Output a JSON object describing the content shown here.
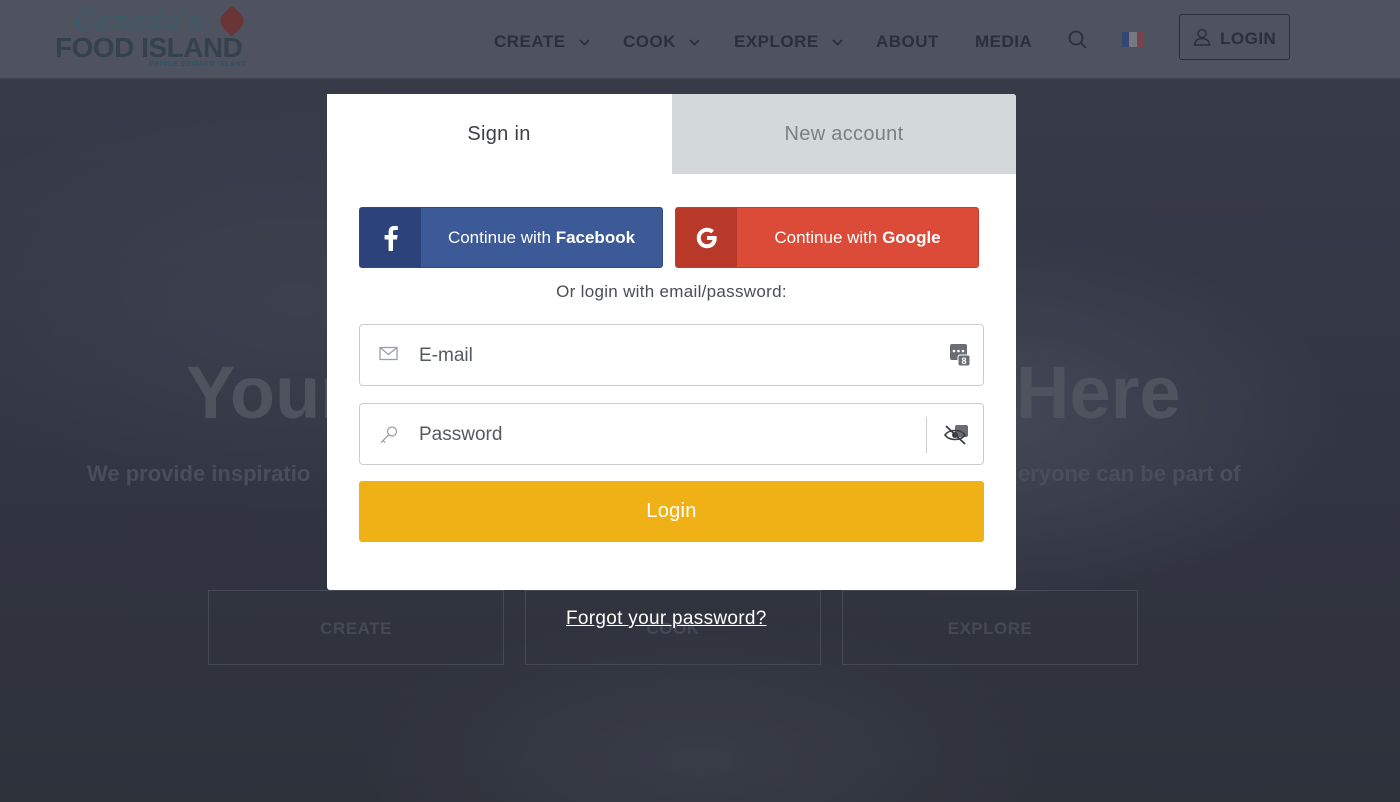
{
  "header": {
    "logo": {
      "script": "Canada's",
      "main": "FOOD ISLAND",
      "sub": "PRINCE EDWARD ISLAND"
    },
    "nav": [
      {
        "label": "CREATE",
        "has_dropdown": true
      },
      {
        "label": "COOK",
        "has_dropdown": true
      },
      {
        "label": "EXPLORE",
        "has_dropdown": true
      },
      {
        "label": "ABOUT",
        "has_dropdown": false
      },
      {
        "label": "MEDIA",
        "has_dropdown": false
      }
    ],
    "search_icon": "search-icon",
    "flag_icon": "french-flag-icon",
    "login_label": "LOGIN"
  },
  "hero": {
    "title_left": "Your",
    "title_right": "Here",
    "subtitle_left": "We provide inspiratio",
    "subtitle_right": "eryone can be part of",
    "buttons": [
      "CREATE",
      "COOK",
      "EXPLORE"
    ]
  },
  "modal": {
    "tabs": {
      "signin": "Sign in",
      "new_account": "New account"
    },
    "facebook": {
      "prefix": "Continue with ",
      "brand": "Facebook",
      "icon": "facebook-icon"
    },
    "google": {
      "prefix": "Continue with ",
      "brand": "Google",
      "icon": "google-icon"
    },
    "or_text": "Or login with email/password:",
    "email": {
      "placeholder": "E-mail",
      "value": ""
    },
    "password": {
      "placeholder": "Password",
      "value": ""
    },
    "submit_label": "Login",
    "forgot_label": "Forgot your password?"
  },
  "colors": {
    "facebook": "#3d5a98",
    "google": "#dc4a38",
    "login_button": "#efb115",
    "tab_inactive": "#d3d9d8"
  }
}
